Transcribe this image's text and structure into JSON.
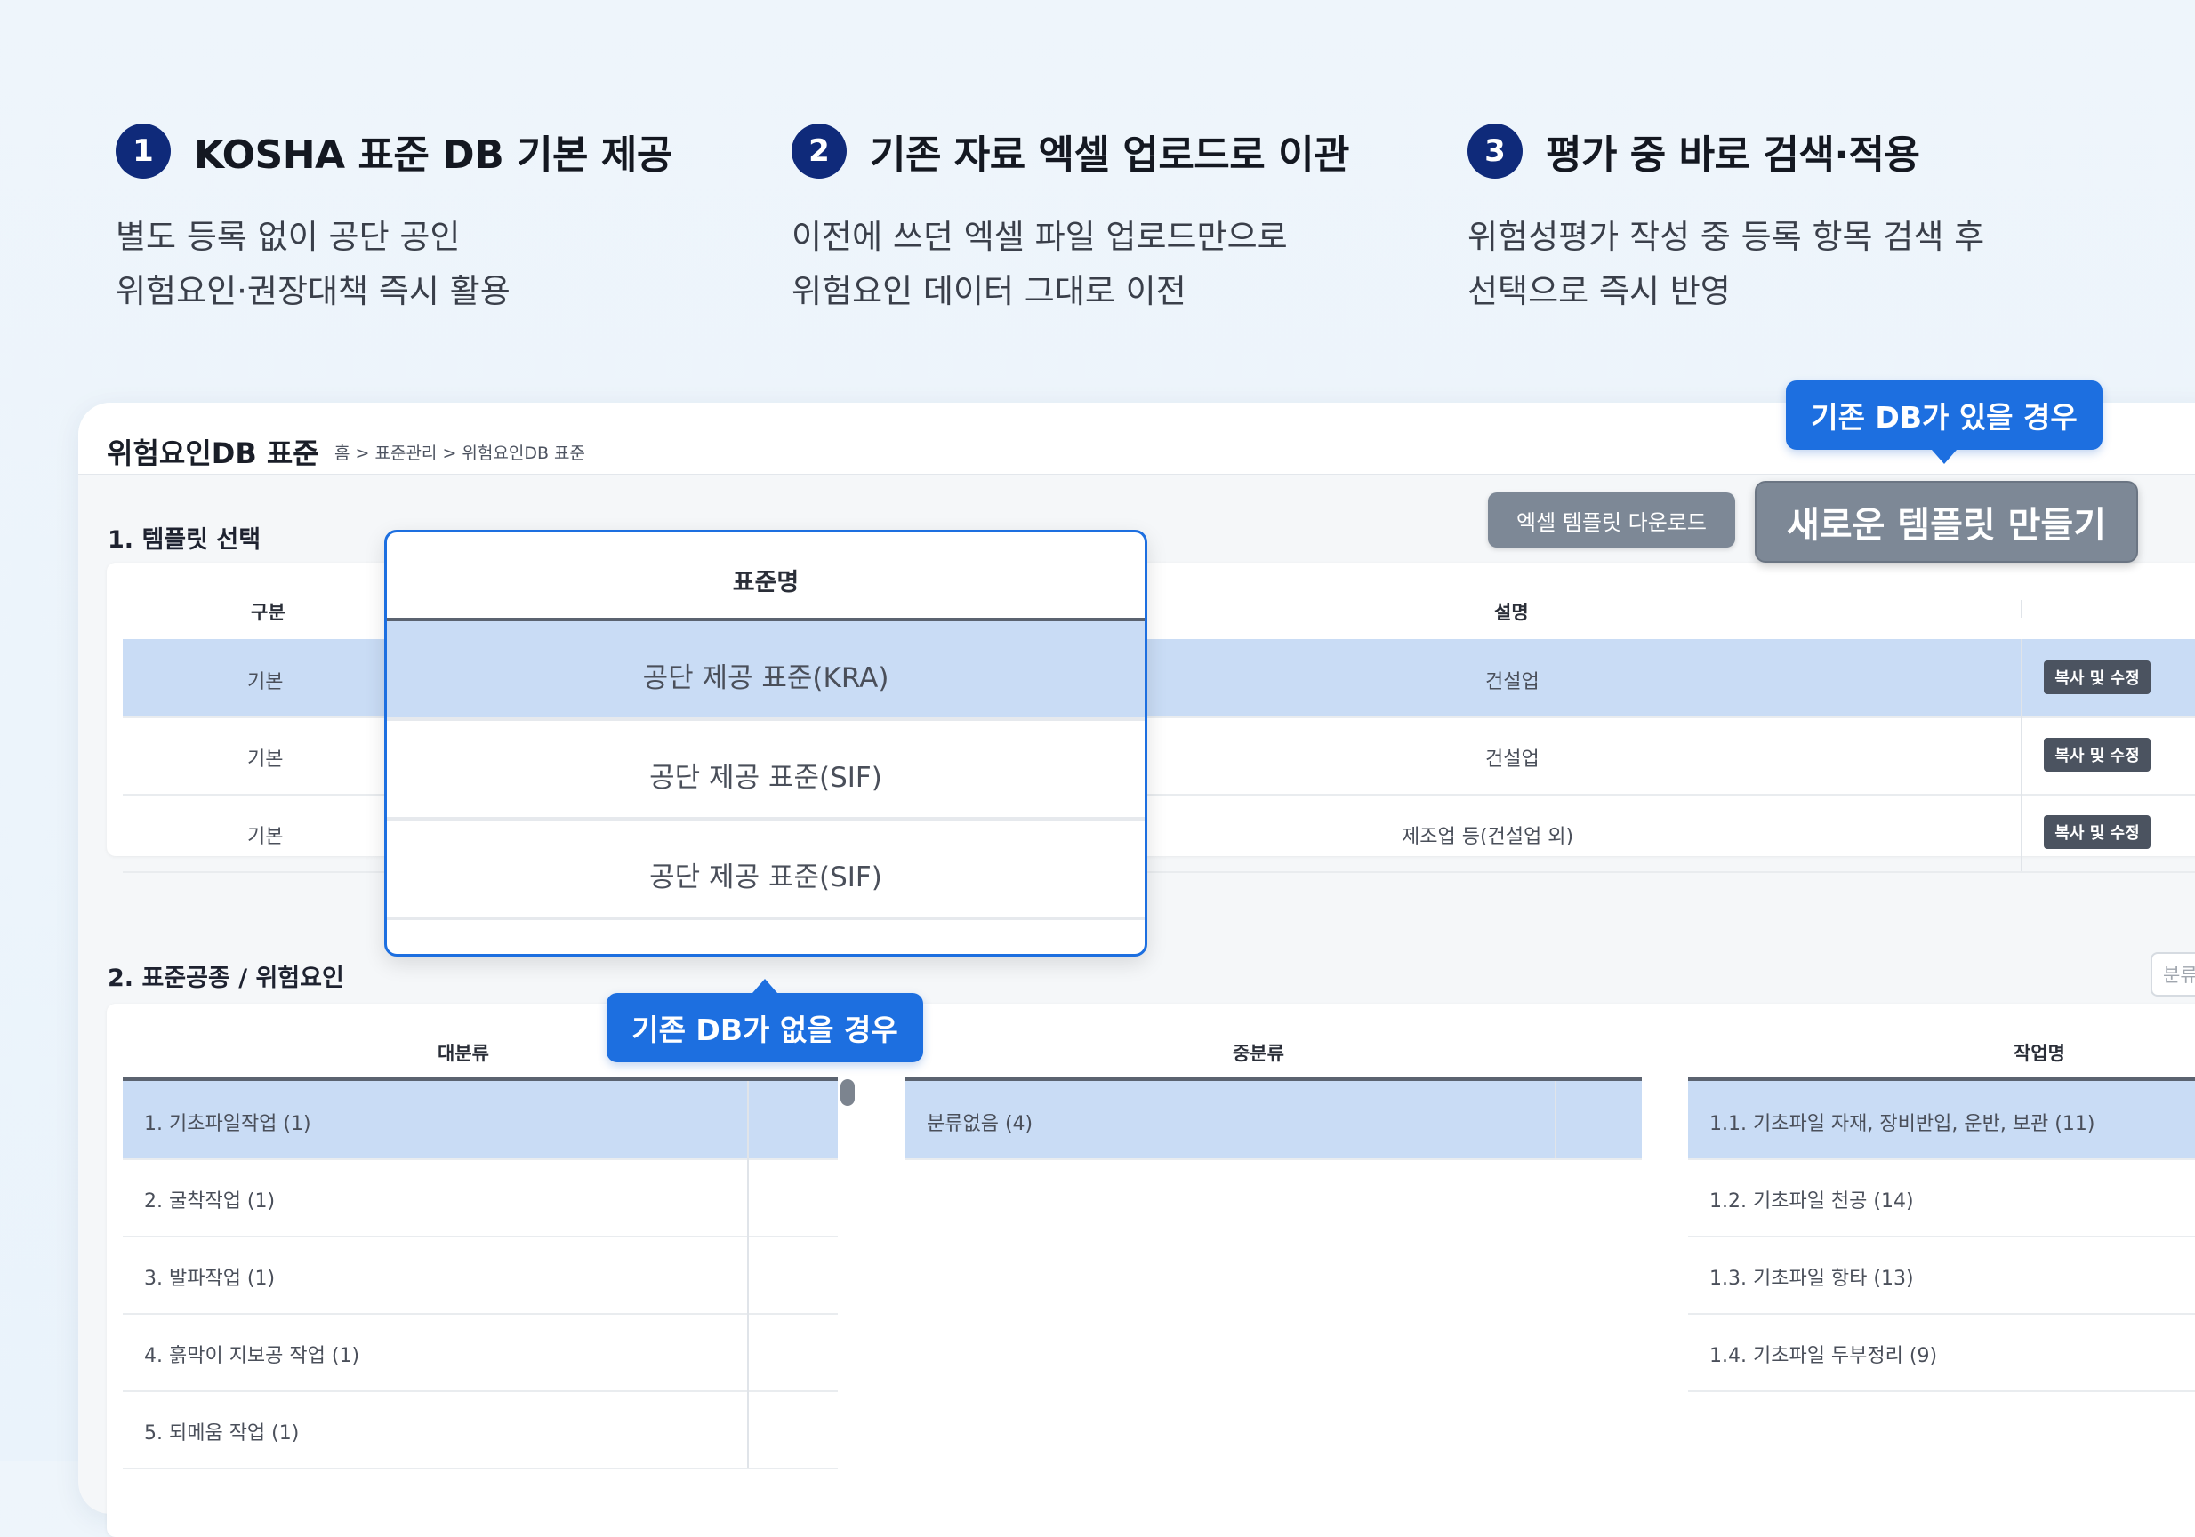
{
  "features": [
    {
      "num": "1",
      "title": "KOSHA 표준 DB 기본 제공",
      "desc1": "별도 등록 없이 공단 공인",
      "desc2": "위험요인·권장대책 즉시 활용"
    },
    {
      "num": "2",
      "title": "기존 자료 엑셀 업로드로 이관",
      "desc1": "이전에 쓰던 엑셀 파일 업로드만으로",
      "desc2": "위험요인 데이터 그대로 이전"
    },
    {
      "num": "3",
      "title": "평가 중 바로 검색·적용",
      "desc1": "위험성평가 작성 중 등록 항목 검색 후",
      "desc2": "선택으로 즉시 반영"
    }
  ],
  "page": {
    "title": "위험요인DB 표준",
    "breadcrumb": "홈 > 표준관리 > 위험요인DB 표준"
  },
  "tooltips": {
    "has_db": "기존 DB가 있을 경우",
    "no_db": "기존 DB가 없을 경우"
  },
  "toolbar": {
    "excel_download": "엑셀 템플릿 다운로드",
    "new_template": "새로운 템플릿 만들기"
  },
  "template_section": {
    "title": "1. 템플릿 선택",
    "headers": {
      "category": "구분",
      "description": "설명"
    },
    "rows": [
      {
        "category": "기본",
        "description": "건설업",
        "action": "복사 및 수정",
        "selected": true
      },
      {
        "category": "기본",
        "description": "건설업",
        "action": "복사 및 수정",
        "selected": false
      },
      {
        "category": "기본",
        "description": "제조업 등(건설업 외)",
        "action": "복사 및 수정",
        "selected": false
      }
    ]
  },
  "popup": {
    "header": "표준명",
    "items": [
      "공단 제공 표준(KRA)",
      "공단 제공 표준(SIF)",
      "공단 제공 표준(SIF)"
    ],
    "selected_index": 0
  },
  "process_section": {
    "title": "2. 표준공종 / 위험요인",
    "filter_placeholder": "분류",
    "major": {
      "header": "대분류",
      "items": [
        "1. 기초파일작업 (1)",
        "2. 굴착작업 (1)",
        "3. 발파작업 (1)",
        "4. 흙막이 지보공 작업 (1)",
        "5. 되메움 작업 (1)"
      ]
    },
    "middle": {
      "header": "중분류",
      "items": [
        "분류없음 (4)"
      ]
    },
    "task": {
      "header": "작업명",
      "items": [
        "1.1. 기초파일 자재, 장비반입, 운반, 보관 (11)",
        "1.2. 기초파일 천공 (14)",
        "1.3. 기초파일 항타 (13)",
        "1.4. 기초파일 두부정리 (9)"
      ]
    }
  }
}
